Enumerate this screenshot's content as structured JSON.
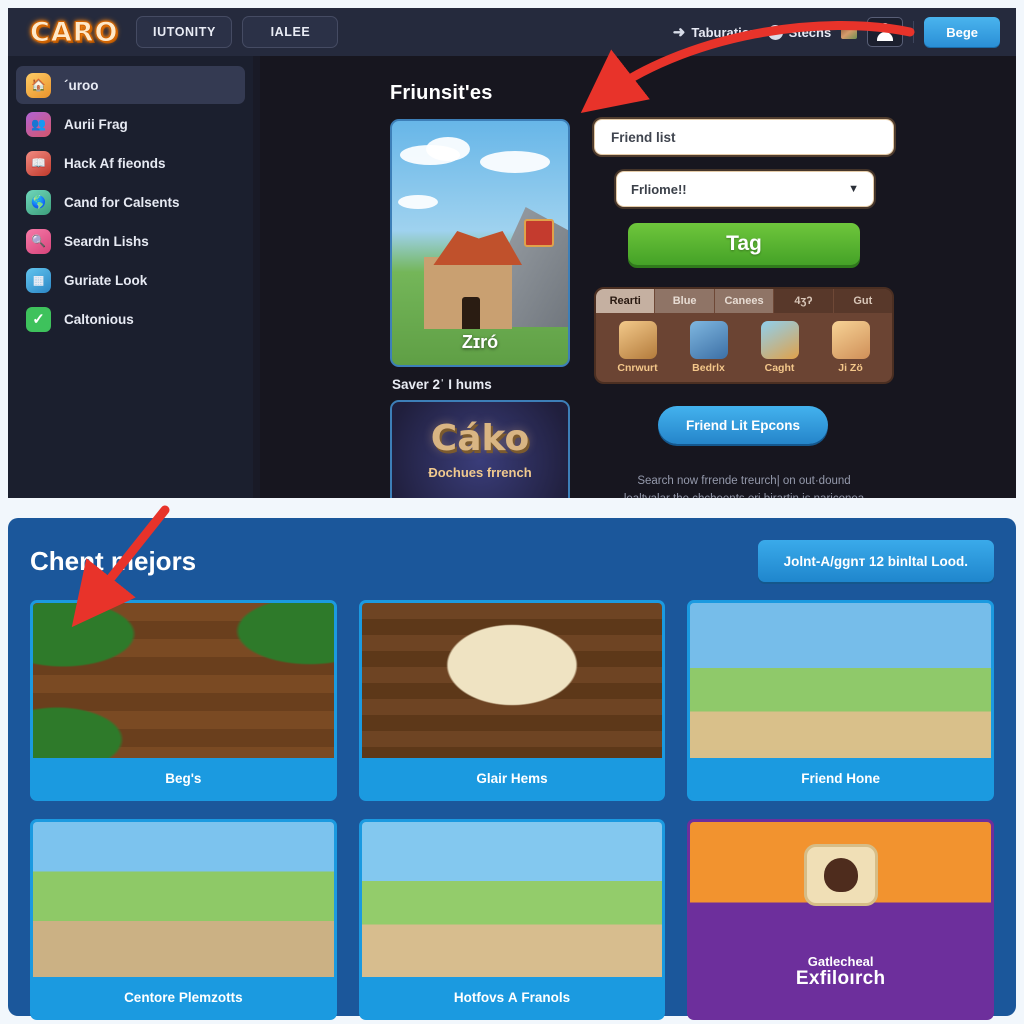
{
  "header": {
    "logo": "CARO",
    "nav": [
      {
        "label": "IUTONITY"
      },
      {
        "label": "IALEE"
      }
    ],
    "back_label": "Taburation",
    "status_label": "Stecns",
    "cta_label": "Bege",
    "icons": {
      "back": "back-arrow-icon",
      "info": "info-icon",
      "thumb": "mini-thumbnail-icon",
      "avatar": "user-avatar-icon"
    }
  },
  "sidebar": {
    "items": [
      {
        "label": "´uroo",
        "icon": "home-icon",
        "active": true
      },
      {
        "label": "Aurii Fraɡ",
        "icon": "friends-icon",
        "active": false
      },
      {
        "label": "Hack Af fieonds",
        "icon": "book-icon",
        "active": false
      },
      {
        "label": "Cand for Calsents",
        "icon": "globe-icon",
        "active": false
      },
      {
        "label": "Seardn Lishs",
        "icon": "search-icon",
        "active": false
      },
      {
        "label": "Guriate Look",
        "icon": "grid-icon",
        "active": false
      },
      {
        "label": "Caltonious",
        "icon": "check-icon",
        "active": false
      }
    ]
  },
  "main": {
    "title": "Friunsit'es",
    "featured_card": {
      "label": "Zɪró"
    },
    "card_subtitle": "Saver 2ˈ I hums",
    "second_card": {
      "logo": "Cáko",
      "subtitle": "Đochues frrench"
    },
    "form": {
      "text_field_value": "Friend list",
      "select_value": "Frliome!!",
      "select_chevron": "chevron-down-icon",
      "submit_label": "Tag"
    },
    "tabs_panel": {
      "tabs": [
        {
          "label": "Rearti",
          "state": "active"
        },
        {
          "label": "Blue",
          "state": "muted"
        },
        {
          "label": "Canees",
          "state": "muted"
        },
        {
          "label": "4ʒʔ",
          "state": "normal"
        },
        {
          "label": "Gut",
          "state": "normal"
        }
      ],
      "avatars": [
        {
          "label": "Cnrwurt",
          "icon": "avatar-character-icon"
        },
        {
          "label": "Bedrlx",
          "icon": "avatar-shield-icon"
        },
        {
          "label": "Caght",
          "icon": "avatar-bird-icon"
        },
        {
          "label": "Јі Zö",
          "icon": "avatar-girl-icon"
        }
      ]
    },
    "pill_button_label": "Friend Lit Epcons",
    "blurb_line1": "Search now frrende treurch| on out·dound",
    "blurb_line2": "lealtvalar the chcheents ori birartin is nariconea"
  },
  "lower": {
    "title": "Chent mеjors",
    "action_label": "Jolnt-A/gɡnт 12 binltal Lood.",
    "tiles": [
      {
        "caption": "Beg's",
        "art": "t-wood",
        "special": false
      },
      {
        "caption": "Glair Hems",
        "art": "t-desk",
        "special": false
      },
      {
        "caption": "Friend Hone",
        "art": "t-village",
        "special": false
      },
      {
        "caption": "Centore Plemzotts",
        "art": "t-houses",
        "special": false
      },
      {
        "caption": "Hotfovs А Franols",
        "art": "t-market",
        "special": false
      },
      {
        "caption_small": "Gatlecheal",
        "caption_big": "Exfiloırch",
        "art": "t-explore",
        "special": true
      }
    ]
  },
  "annotations": {
    "arrow_color": "#e8332a",
    "arrow_top_target": "featured-card-top-right",
    "arrow_bottom_target": "first-tile-top-left"
  },
  "colors": {
    "page_bg": "#f2f7fc",
    "app_bg": "#191a26",
    "topbar": "#252a3d",
    "sidebar": "#1b1f2e",
    "content": "#17161f",
    "lower_panel": "#1b579b",
    "tile_caption": "#1b9ae0",
    "accent_blue": "#2a8fd6",
    "accent_green": "#45a227",
    "accent_purple": "#6d2f9c"
  }
}
